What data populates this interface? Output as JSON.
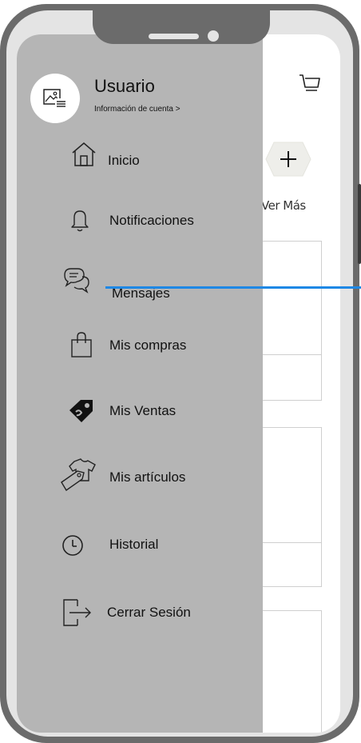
{
  "drawer": {
    "user_name": "Usuario",
    "account_link": "Información de cuenta >",
    "items": [
      {
        "label": "Inicio",
        "icon": "home-icon"
      },
      {
        "label": "Notificaciones",
        "icon": "bell-icon"
      },
      {
        "label": "Mensajes",
        "icon": "chat-bubbles-icon"
      },
      {
        "label": "Mis compras",
        "icon": "shopping-bag-icon"
      },
      {
        "label": "Mis Ventas",
        "icon": "price-tag-icon"
      },
      {
        "label": "Mis artículos",
        "icon": "clothing-tag-icon"
      },
      {
        "label": "Historial",
        "icon": "clock-icon"
      },
      {
        "label": "Cerrar Sesión",
        "icon": "logout-icon"
      }
    ]
  },
  "background": {
    "ver_mas": "Ver Más",
    "icons": [
      "cart-icon",
      "plus-icon"
    ]
  },
  "colors": {
    "drawer_bg": "#b5b5b5",
    "phone_frame": "#6b6b6b",
    "highlight_line": "#1e88e5"
  }
}
